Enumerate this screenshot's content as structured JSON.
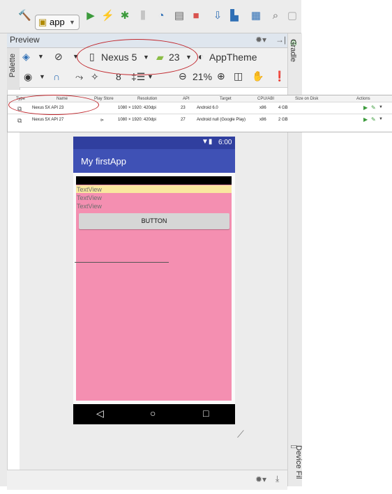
{
  "toolbar": {
    "config": "app",
    "icons": [
      "hammer-icon",
      "run-icon",
      "apply-changes-icon",
      "debug-icon",
      "attach-debugger-icon",
      "profile-icon",
      "coverage-icon",
      "stop-icon",
      "sync-icon",
      "avd-manager-icon",
      "project-structure-icon",
      "search-icon"
    ]
  },
  "preview": {
    "title": "Preview",
    "device": "Nexus 5",
    "api": "23",
    "theme": "AppTheme",
    "zoom": "21%"
  },
  "side": {
    "palette": "Palette",
    "gradle": "Gradle",
    "device_file": "Device Fil"
  },
  "avd_table": {
    "headers": [
      "Type",
      "Name",
      "Play Store",
      "Resolution",
      "API",
      "Target",
      "CPU/ABI",
      "Size on Disk",
      "Actions"
    ],
    "rows": [
      {
        "name": "Nexus 5X API 23",
        "play": "",
        "resolution": "1080 × 1920: 420dpi",
        "api": "23",
        "target": "Android 6.0",
        "cpu": "x86",
        "size": "4 GB"
      },
      {
        "name": "Nexus 5X API 27",
        "play": "⊳",
        "resolution": "1080 × 1920: 420dpi",
        "api": "27",
        "target": "Android null (Google Play)",
        "cpu": "x86",
        "size": "2 GB"
      }
    ]
  },
  "phone": {
    "time": "6:00",
    "app_title": "My firstApp",
    "textviews": [
      "TextView",
      "TextView",
      "TextView"
    ],
    "button": "BUTTON"
  },
  "colors": {
    "annotation": "#c1272d",
    "app_bar": "#3f51b5",
    "layout_bg": "#f48fb1"
  }
}
